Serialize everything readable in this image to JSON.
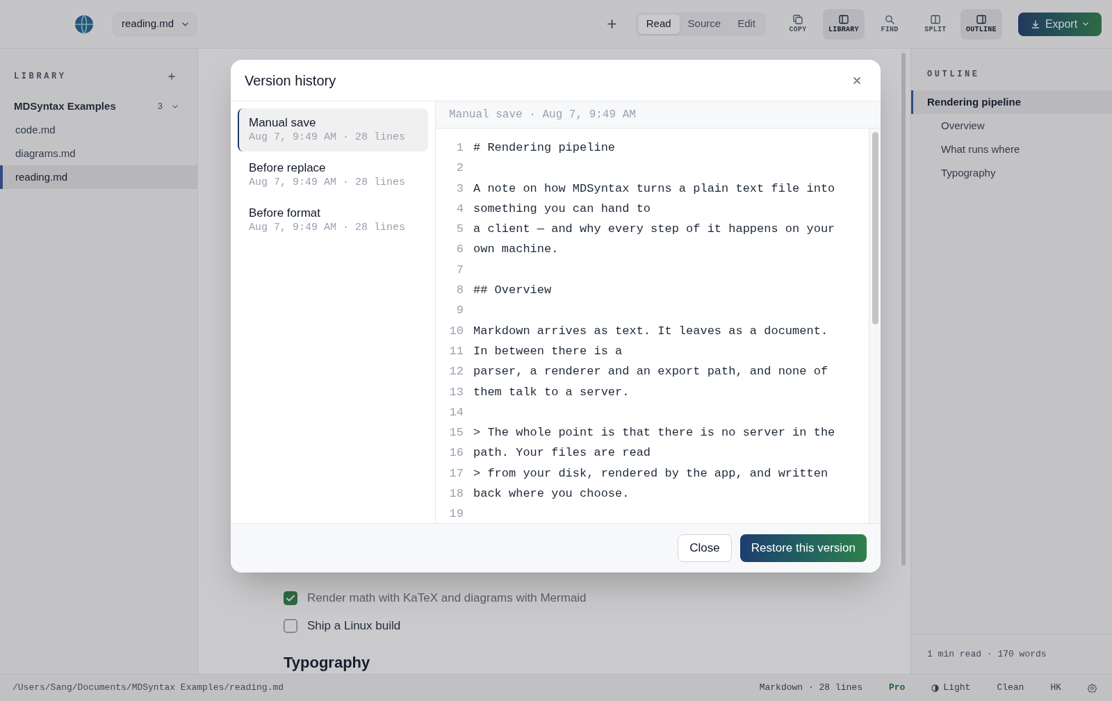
{
  "app_bar": {
    "tab": {
      "label": "reading.md"
    },
    "modes": [
      {
        "label": "Read",
        "selected": true
      },
      {
        "label": "Source",
        "selected": false
      },
      {
        "label": "Edit",
        "selected": false
      }
    ],
    "tools": [
      {
        "kind": "copy",
        "label": "COPY",
        "active": false
      },
      {
        "kind": "library",
        "label": "LIBRARY",
        "active": true
      },
      {
        "kind": "find",
        "label": "FIND",
        "active": false
      },
      {
        "kind": "split",
        "label": "SPLIT",
        "active": false
      },
      {
        "kind": "outline",
        "label": "OUTLINE",
        "active": true
      }
    ],
    "export_button": {
      "label": "Export"
    }
  },
  "library": {
    "title": "LIBRARY",
    "folder": {
      "name": "MDSyntax Examples",
      "count": "3",
      "expanded": true,
      "files": [
        {
          "name": "code.md",
          "selected": false
        },
        {
          "name": "diagrams.md",
          "selected": false
        },
        {
          "name": "reading.md",
          "selected": true
        }
      ]
    }
  },
  "document": {
    "tasks": [
      {
        "text": "Render math with KaTeX and diagrams with Mermaid",
        "checked": true
      },
      {
        "text": "Ship a Linux build",
        "checked": false
      }
    ],
    "heading": "Typography"
  },
  "outline": {
    "title": "OUTLINE",
    "items": [
      {
        "label": "Rendering pipeline",
        "selected": true,
        "children": [
          {
            "label": "Overview",
            "selected": false
          },
          {
            "label": "What runs where",
            "selected": false
          },
          {
            "label": "Typography",
            "selected": false
          }
        ]
      }
    ],
    "footer": "1 min read · 170 words"
  },
  "status_bar": {
    "path": "/Users/Sang/Documents/MDSyntax Examples/reading.md",
    "items": [
      {
        "kind": "text",
        "label": "Markdown · 28 lines"
      },
      {
        "kind": "plan",
        "label": "Pro"
      },
      {
        "kind": "theme",
        "label": "Light"
      },
      {
        "kind": "text",
        "label": "Clean"
      },
      {
        "kind": "text",
        "label": "HK"
      },
      {
        "kind": "settings"
      }
    ]
  },
  "dialog": {
    "title": "Version history",
    "versions": [
      {
        "title": "Manual save",
        "meta": "Aug 7, 9:49 AM · 28 lines",
        "selected": true
      },
      {
        "title": "Before replace",
        "meta": "Aug 7, 9:49 AM · 28 lines",
        "selected": false
      },
      {
        "title": "Before format",
        "meta": "Aug 7, 9:49 AM · 28 lines",
        "selected": false
      }
    ],
    "preview": {
      "header": "Manual save · Aug 7, 9:49 AM",
      "lines": [
        {
          "number": "1",
          "text": "# Rendering pipeline"
        },
        {
          "number": "2"
        },
        {
          "number": "3",
          "text": "A note on how MDSyntax turns a plain text file into"
        },
        {
          "number": "4",
          "text": "something you can hand to"
        },
        {
          "number": "5",
          "text": "a client — and why every step of it happens on your"
        },
        {
          "number": "6",
          "text": "own machine."
        },
        {
          "number": "7"
        },
        {
          "number": "8",
          "text": "## Overview"
        },
        {
          "number": "9"
        },
        {
          "number": "10",
          "text": "Markdown arrives as text. It leaves as a document."
        },
        {
          "number": "11",
          "text": "In between there is a"
        },
        {
          "number": "12",
          "text": "parser, a renderer and an export path, and none of"
        },
        {
          "number": "13",
          "text": "them talk to a server."
        },
        {
          "number": "14"
        },
        {
          "number": "15",
          "text": "> The whole point is that there is no server in the"
        },
        {
          "number": "16",
          "text": "path. Your files are read"
        },
        {
          "number": "17",
          "text": "> from your disk, rendered by the app, and written"
        },
        {
          "number": "18",
          "text": "back where you choose."
        },
        {
          "number": "19"
        }
      ]
    },
    "buttons": [
      {
        "kind": "secondary",
        "label": "Close"
      },
      {
        "kind": "primary",
        "label": "Restore this version"
      }
    ]
  }
}
